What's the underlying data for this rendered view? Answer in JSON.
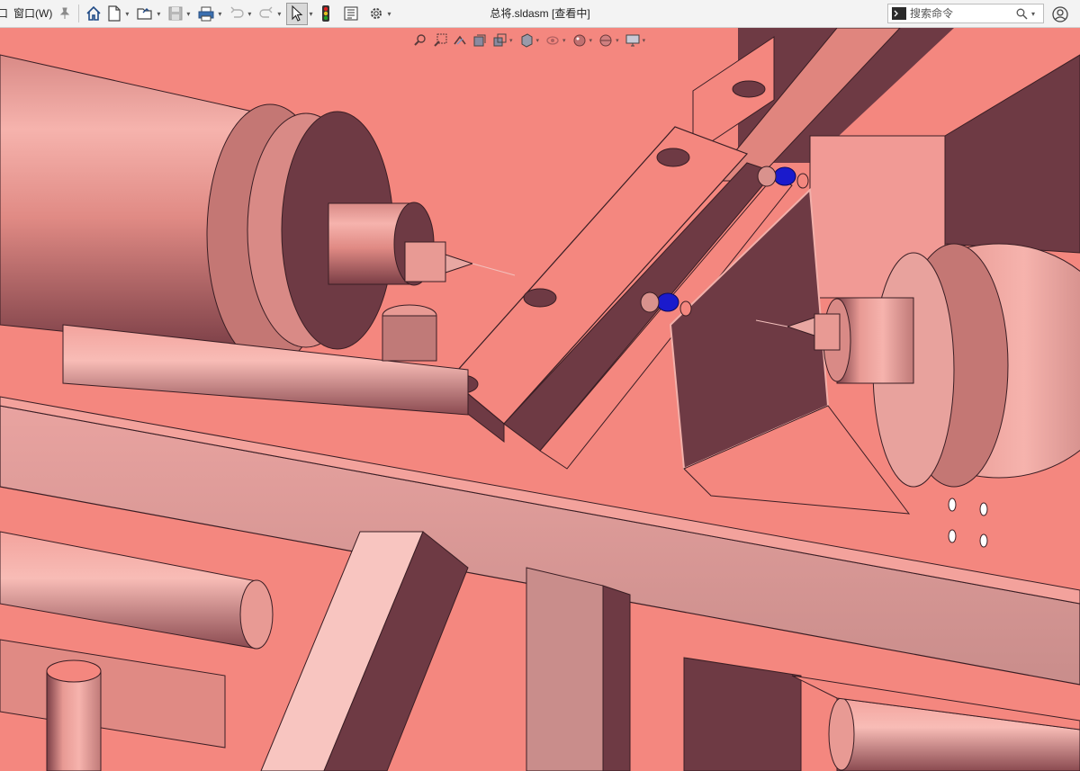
{
  "menubar": {
    "items": [
      {
        "label": "口",
        "name": "menu-partial-cut"
      },
      {
        "label": "窗口(W)",
        "name": "menu-window"
      }
    ]
  },
  "toolbar": {
    "buttons": [
      {
        "name": "home-button",
        "icon": "home-icon"
      },
      {
        "name": "new-document-button",
        "icon": "new-document-icon"
      },
      {
        "name": "open-button",
        "icon": "folder-open-icon"
      },
      {
        "name": "save-button",
        "icon": "save-icon"
      },
      {
        "name": "print-button",
        "icon": "print-icon"
      },
      {
        "name": "undo-button",
        "icon": "undo-icon"
      },
      {
        "name": "redo-button",
        "icon": "redo-icon"
      },
      {
        "name": "select-button",
        "icon": "cursor-arrow-icon"
      },
      {
        "name": "rebuild-button",
        "icon": "traffic-light-icon"
      },
      {
        "name": "file-properties-button",
        "icon": "file-properties-icon"
      },
      {
        "name": "options-button",
        "icon": "gear-icon"
      }
    ]
  },
  "title": "总将.sldasm [查看中]",
  "search": {
    "placeholder": "搜索命令",
    "value": ""
  },
  "heads_up_toolbar": [
    "zoom-to-fit-icon",
    "zoom-to-area-icon",
    "previous-view-icon",
    "section-view-icon",
    "view-orientation-icon",
    "display-style-icon",
    "hide-show-items-icon",
    "edit-appearance-icon",
    "apply-scene-icon",
    "view-settings-icon"
  ],
  "colors": {
    "part_light": "#f4877f",
    "part_dark": "#6e3a44",
    "part_mid": "#c07a78",
    "fastener_blue": "#1a1acc",
    "toolbar_bg": "#f3f3f3"
  }
}
